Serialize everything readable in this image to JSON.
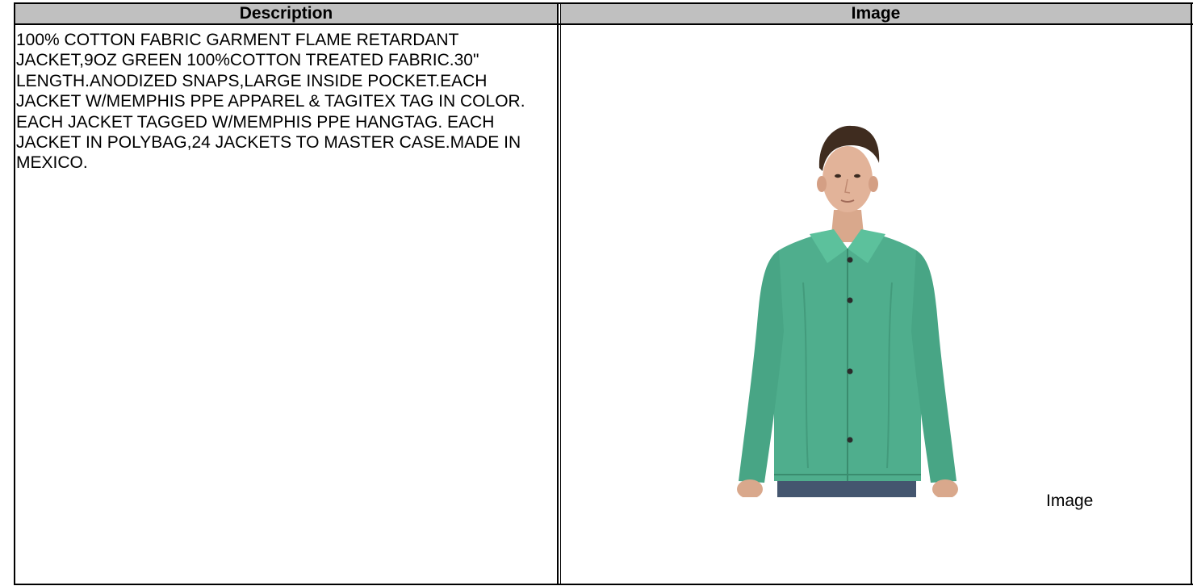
{
  "table": {
    "headers": [
      "Description",
      "Image"
    ],
    "rows": [
      {
        "description": "100% COTTON FABRIC GARMENT FLAME RETARDANT JACKET,9OZ GREEN 100%COTTON TREATED FABRIC.30\" LENGTH.ANODIZED SNAPS,LARGE INSIDE POCKET.EACH JACKET W/MEMPHIS PPE APPAREL & TAGITEX TAG IN COLOR. EACH JACKET TAGGED W/MEMPHIS PPE HANGTAG. EACH JACKET IN POLYBAG,24 JACKETS TO MASTER CASE.MADE IN MEXICO.",
        "image_alt": "Image"
      }
    ]
  },
  "colors": {
    "header_bg": "#c0c0c0",
    "jacket": "#4fae8d",
    "border": "#000000"
  }
}
